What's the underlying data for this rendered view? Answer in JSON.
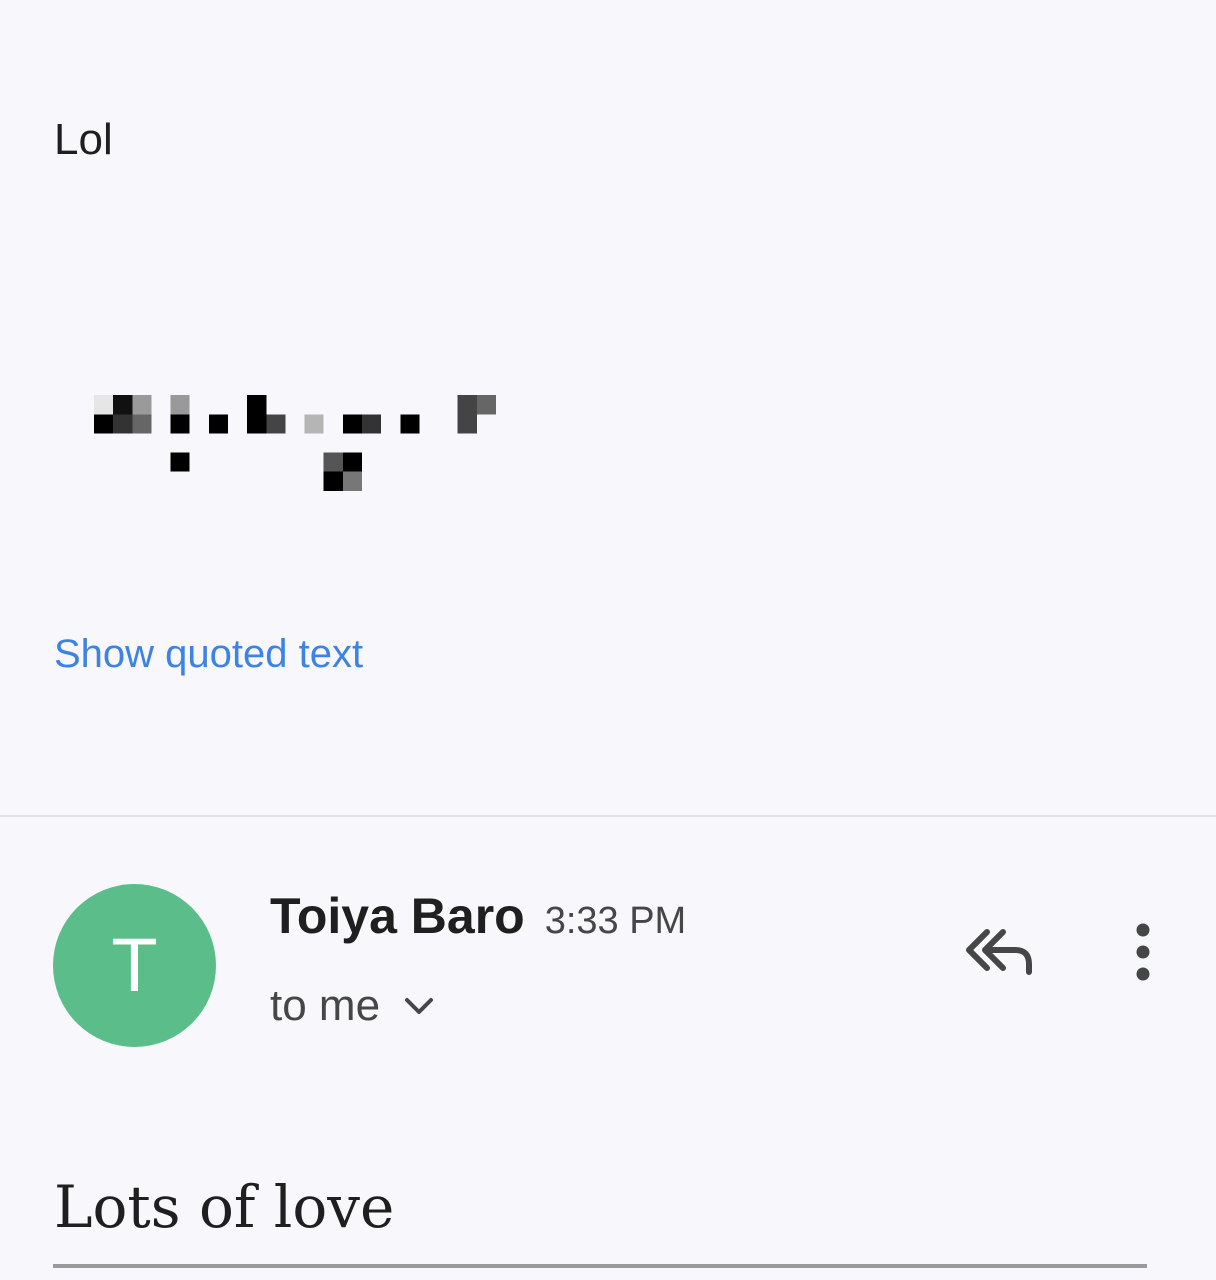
{
  "message_previous": {
    "body": "Lol",
    "show_quoted_label": "Show quoted text"
  },
  "message_current": {
    "avatar_initial": "T",
    "avatar_color": "#5bbd8a",
    "sender_name": "Toiya Baro",
    "time": "3:33 PM",
    "recipient": "to me",
    "body": "Lots of love"
  },
  "icons": {
    "recipient_details": "chevron-down-icon",
    "reply_all": "reply-all-icon",
    "more": "more-vert-icon"
  },
  "colors": {
    "link": "#3d83e4",
    "background": "#f8f7fc",
    "icon": "#444746"
  }
}
